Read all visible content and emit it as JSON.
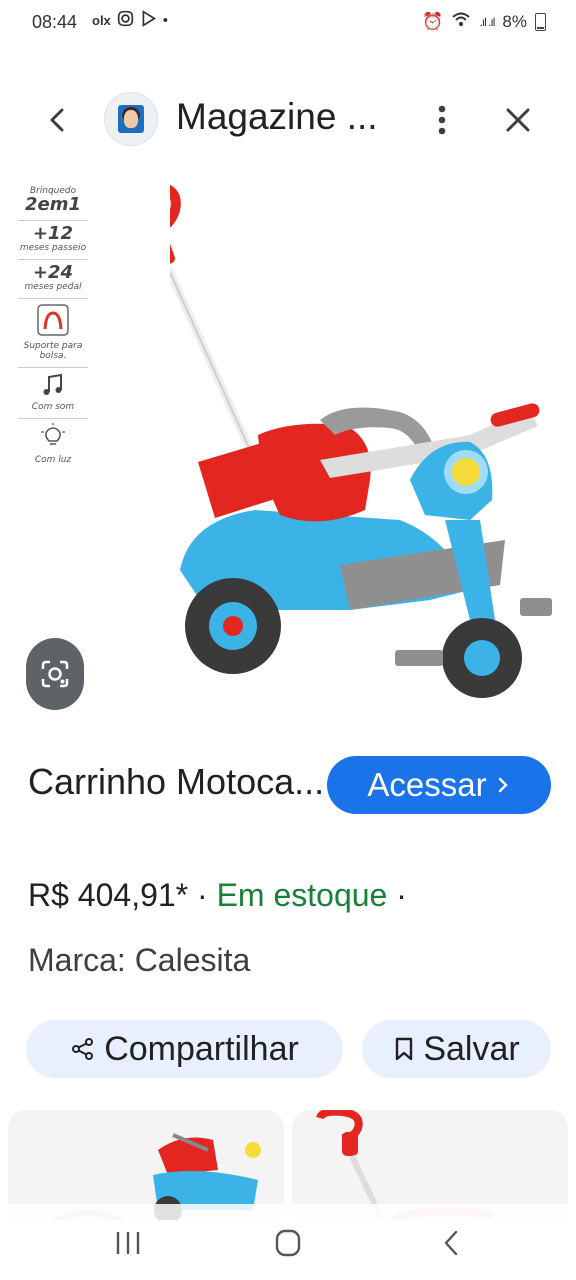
{
  "status_bar": {
    "time": "08:44",
    "olx": "olx",
    "battery": "8%"
  },
  "header": {
    "site_title": "Magazine ...",
    "back_icon": "chevron-left-icon",
    "more_icon": "more-vertical-icon",
    "close_icon": "close-icon"
  },
  "product_image": {
    "features": [
      {
        "big": "2em1",
        "small": "Brinquedo"
      },
      {
        "big": "+12",
        "small": "meses passeio"
      },
      {
        "big": "+24",
        "small": "meses pedal"
      },
      {
        "big": "",
        "small": "Suporte para bolsa."
      },
      {
        "big": "",
        "small": "Com som"
      },
      {
        "big": "",
        "small": "Com luz"
      }
    ],
    "lens_icon": "google-lens-icon"
  },
  "product": {
    "title": "Carrinho Motoca...",
    "access_button": "Acessar",
    "price": "R$ 404,91*",
    "separator": " · ",
    "stock": "Em estoque",
    "trailing_sep": " ·",
    "brand": "Marca: Calesita"
  },
  "actions": {
    "share_label": "Compartilhar",
    "save_label": "Salvar"
  },
  "colors": {
    "accent": "#1a73e8",
    "stock_green": "#188038",
    "chip_bg": "#e8f0fe"
  }
}
